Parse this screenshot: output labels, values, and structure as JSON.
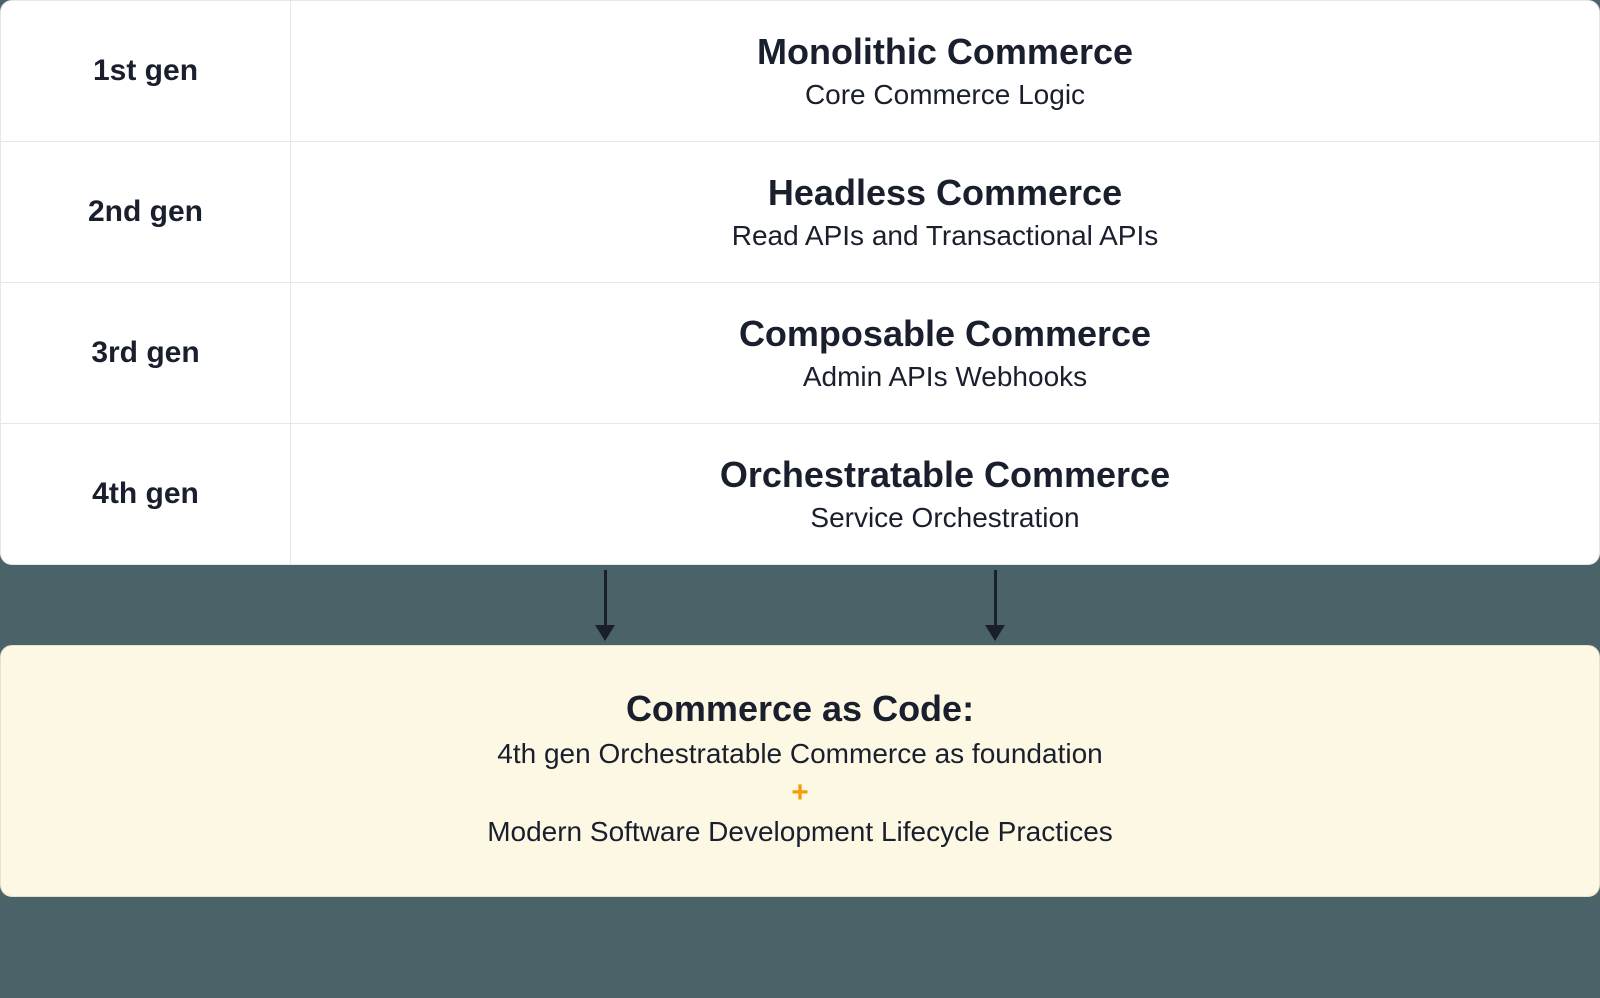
{
  "generations": [
    {
      "label": "1st gen",
      "title": "Monolithic Commerce",
      "subtitle": "Core Commerce Logic"
    },
    {
      "label": "2nd gen",
      "title": "Headless Commerce",
      "subtitle": "Read APIs and Transactional APIs"
    },
    {
      "label": "3rd gen",
      "title": "Composable Commerce",
      "subtitle": "Admin APIs Webhooks"
    },
    {
      "label": "4th gen",
      "title": "Orchestratable Commerce",
      "subtitle": "Service Orchestration"
    }
  ],
  "bottom": {
    "title": "Commerce as Code:",
    "line1": "4th gen Orchestratable Commerce as foundation",
    "plus": "+",
    "line2": "Modern Software Development Lifecycle Practices"
  }
}
